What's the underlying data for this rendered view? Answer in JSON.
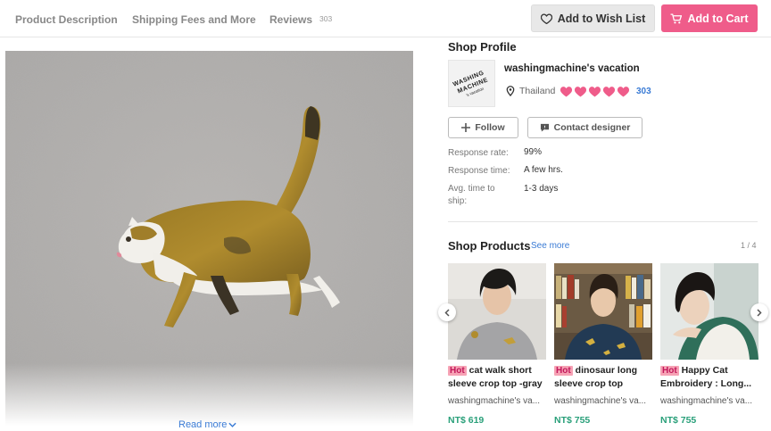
{
  "tabs": [
    {
      "label": "Product Description"
    },
    {
      "label": "Shipping Fees and More"
    },
    {
      "label": "Reviews",
      "count": "303"
    }
  ],
  "actions": {
    "wishlist_label": "Add to Wish List",
    "cart_label": "Add to Cart"
  },
  "product": {
    "read_more": "Read more"
  },
  "shop": {
    "section_title": "Shop Profile",
    "name": "washingmachine's vacation",
    "location": "Thailand",
    "rating_hearts": 5,
    "review_count": "303",
    "follow_label": "Follow",
    "contact_label": "Contact designer",
    "logo_text": [
      "WASHING",
      "MACHINE",
      "'s vacation"
    ],
    "stats": [
      {
        "label": "Response rate:",
        "value": "99%"
      },
      {
        "label": "Response time:",
        "value": "A few hrs."
      },
      {
        "label": "Avg. time to ship:",
        "value": "1-3 days"
      }
    ]
  },
  "shop_products": {
    "title": "Shop Products",
    "see_more": "See more",
    "pager": "1 / 4",
    "items": [
      {
        "hot": "Hot",
        "title": "cat walk short sleeve crop top -gray",
        "shop": "washingmachine's va...",
        "price": "NT$ 619"
      },
      {
        "hot": "Hot",
        "title": "dinosaur long sleeve crop top",
        "shop": "washingmachine's va...",
        "price": "NT$ 755"
      },
      {
        "hot": "Hot",
        "title": "Happy Cat Embroidery : Long...",
        "shop": "washingmachine's va...",
        "price": "NT$ 755"
      }
    ]
  },
  "colors": {
    "accent_pink": "#ef5c8a",
    "link_blue": "#3a7bd5",
    "price_green": "#2aa07a"
  }
}
